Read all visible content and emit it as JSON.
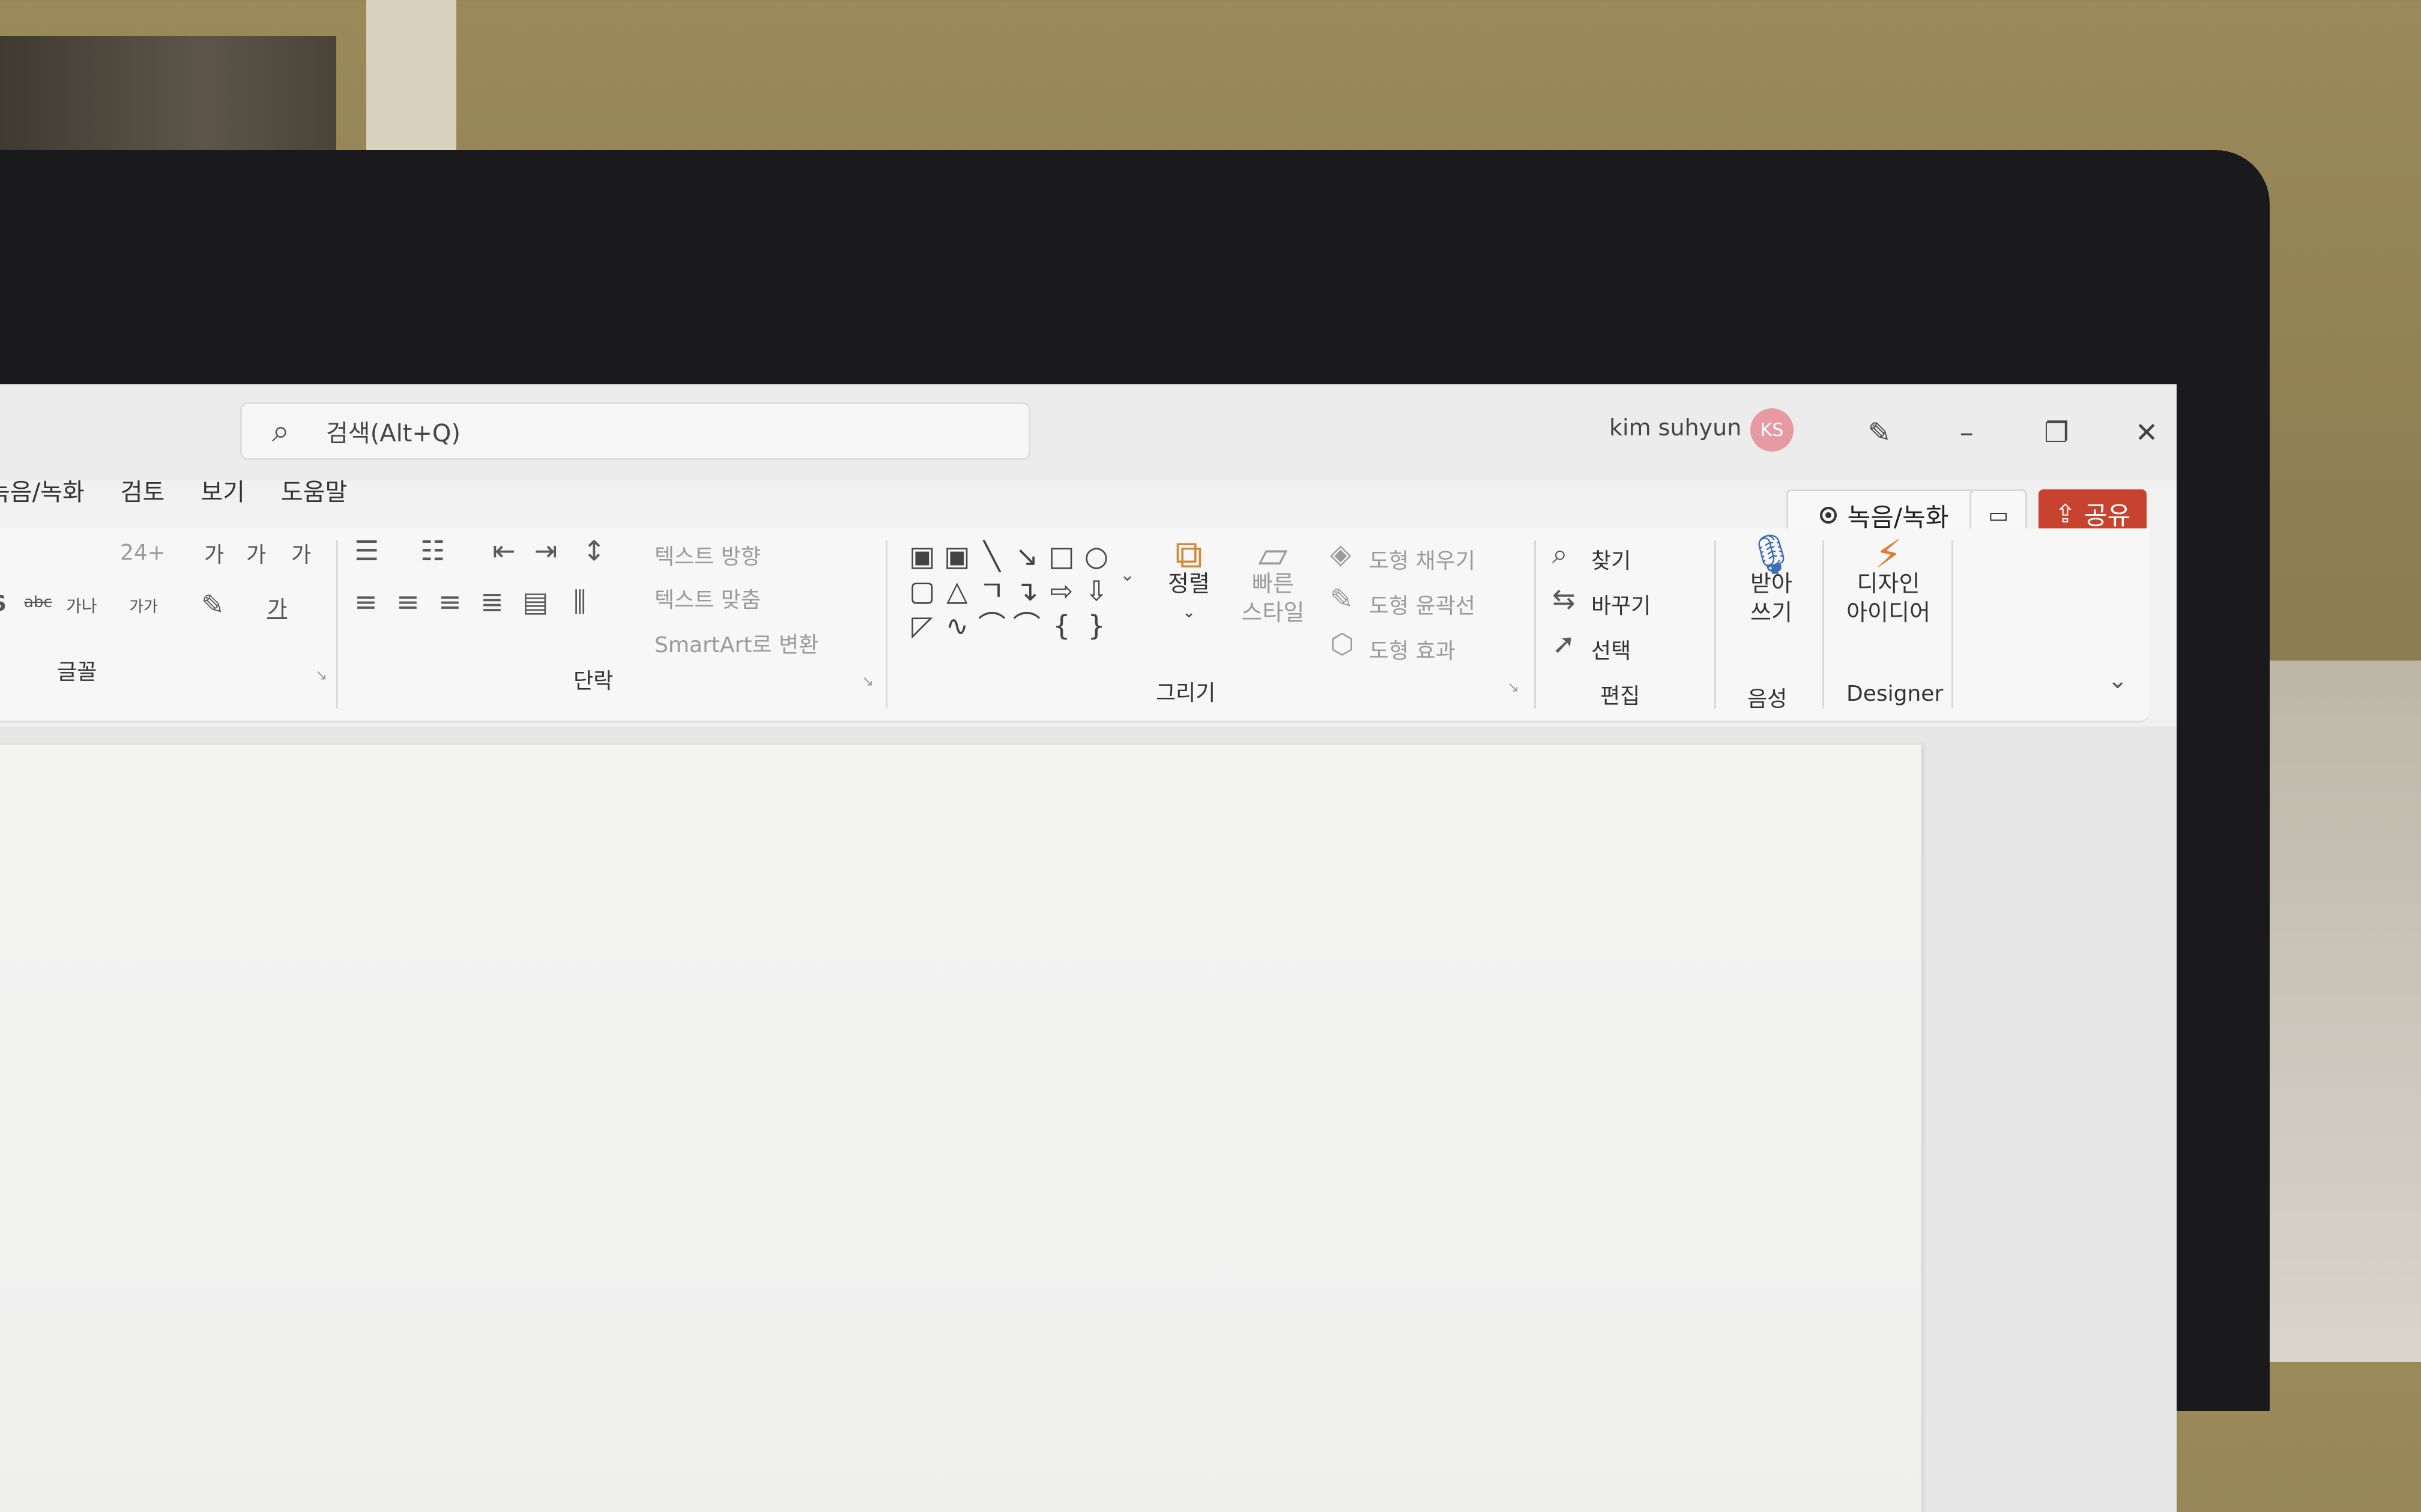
{
  "title_bar": {
    "search_placeholder": "검색(Alt+Q)",
    "user_name": "kim suhyun",
    "avatar_initials": "KS",
    "icons": [
      "search-icon",
      "pen-icon",
      "minimize-icon",
      "restore-icon",
      "close-icon"
    ]
  },
  "menu": {
    "items": [
      "녹음/녹화",
      "검토",
      "보기",
      "도움말"
    ]
  },
  "top_right": {
    "record_label": "녹음/녹화",
    "share_label": "공유"
  },
  "ribbon": {
    "font_group": {
      "label": "글꼴",
      "font_size": "24+",
      "grow_font": "가",
      "shrink_font": "가",
      "clear_format": "가",
      "shadow": "S",
      "strike": "abc",
      "spacing": "가나",
      "case": "가가",
      "font_color": "가"
    },
    "paragraph_group": {
      "label": "단락",
      "text_direction": "텍스트 방향",
      "align_text": "텍스트 맞춤",
      "smartart": "SmartArt로 변환"
    },
    "drawing_group": {
      "label": "그리기",
      "arrange": "정렬",
      "quick_styles_line1": "빠른",
      "quick_styles_line2": "스타일",
      "shape_fill": "도형 채우기",
      "shape_outline": "도형 윤곽선",
      "shape_effects": "도형 효과"
    },
    "editing_group": {
      "label": "편집",
      "find": "찾기",
      "replace": "바꾸기",
      "select": "선택"
    },
    "voice_group": {
      "label": "음성",
      "dictate_line1": "받아",
      "dictate_line2": "쓰기"
    },
    "designer_group": {
      "label": "Designer",
      "design_ideas_line1": "디자인",
      "design_ideas_line2": "아이디어"
    }
  },
  "colors": {
    "share_button": "#c8432f",
    "avatar": "#e79aa3",
    "mic": "#3d6fb5",
    "designer": "#e07a2e"
  }
}
